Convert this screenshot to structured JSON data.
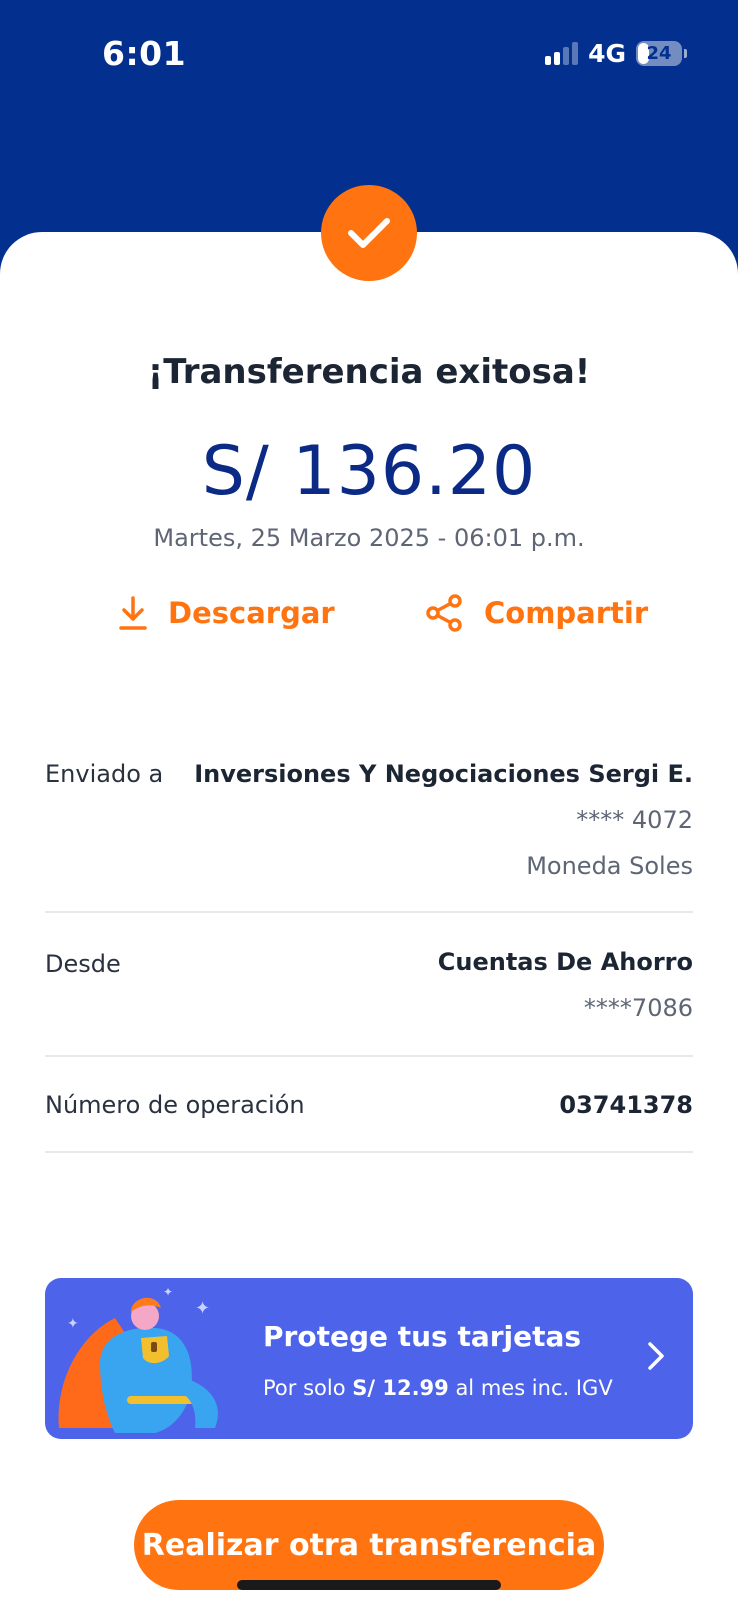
{
  "status_bar": {
    "time": "6:01",
    "network": "4G",
    "battery": "24"
  },
  "receipt": {
    "title": "¡Transferencia exitosa!",
    "amount": "S/ 136.20",
    "datetime": "Martes, 25 Marzo 2025 - 06:01 p.m."
  },
  "actions": {
    "download_label": "Descargar",
    "share_label": "Compartir"
  },
  "details": {
    "sent_to": {
      "label": "Enviado a",
      "name": "Inversiones Y Negociaciones Sergi E.",
      "account": "**** 4072",
      "currency": "Moneda Soles"
    },
    "from": {
      "label": "Desde",
      "account_type": "Cuentas De Ahorro",
      "account": "****7086"
    },
    "operation": {
      "label": "Número de operación",
      "number": "03741378"
    }
  },
  "promo": {
    "title": "Protege tus tarjetas",
    "sub_prefix": "Por solo ",
    "sub_price": "S/ 12.99",
    "sub_suffix": " al mes inc. IGV"
  },
  "cta_label": "Realizar otra transferencia",
  "colors": {
    "header": "#03308f",
    "accent": "#ff7410",
    "amount": "#0b2a86",
    "promo": "#4c63ea"
  }
}
